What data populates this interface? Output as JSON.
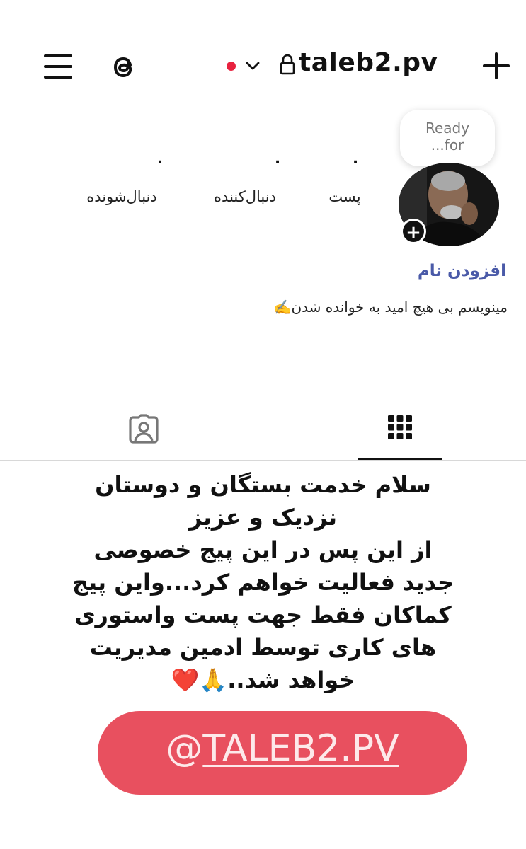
{
  "header": {
    "username": "taleb2.pv",
    "icons": [
      "menu-icon",
      "threads-icon",
      "chevron-down-icon",
      "lock-icon",
      "plus-icon"
    ]
  },
  "profile": {
    "note": "Ready for...",
    "note_line1": "Ready",
    "note_line2": "...for",
    "stats": [
      {
        "value": ".",
        "label": "پست"
      },
      {
        "value": ".",
        "label": "دنبال‌کننده"
      },
      {
        "value": ".",
        "label": "دنبال‌شونده"
      }
    ],
    "add_name": "افزودن نام",
    "bio": "مینویسم بی هیچ امید به خوانده شدن✍️"
  },
  "tabs": [
    {
      "name": "grid",
      "active": true
    },
    {
      "name": "tagged",
      "active": false
    }
  ],
  "story": {
    "lines": [
      "سلام خدمت بستگان و دوستان",
      "نزدیک و عزیز",
      "از این پس  در این پیج خصوصی",
      "جدید فعالیت خواهم کرد...واین پیج",
      "کماکان فقط جهت پست واستوری",
      "های کاری توسط ادمین مدیریت",
      "خواهد شد..🙏❤️"
    ],
    "link_at": "@",
    "link_handle": "TALEB2.PV"
  },
  "colors": {
    "status_dot": "#e8223f",
    "link_pill": "#e8505f",
    "add_name": "#4a5aa8"
  }
}
